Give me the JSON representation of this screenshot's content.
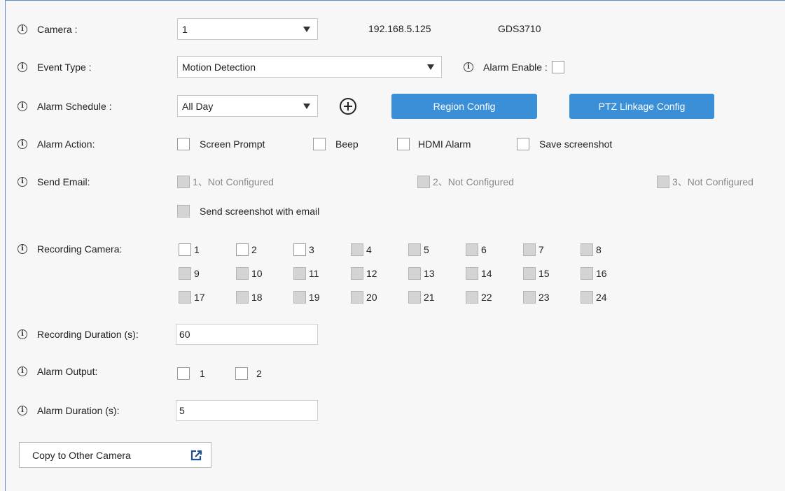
{
  "fields": {
    "camera": {
      "label": "Camera :",
      "value": "1",
      "ip": "192.168.5.125",
      "model": "GDS3710"
    },
    "event_type": {
      "label": "Event Type :",
      "value": "Motion Detection"
    },
    "alarm_enable": {
      "label": "Alarm Enable :",
      "checked": false
    },
    "alarm_schedule": {
      "label": "Alarm Schedule :",
      "value": "All Day"
    },
    "region_config": {
      "label": "Region Config"
    },
    "ptz_linkage": {
      "label": "PTZ Linkage Config"
    },
    "alarm_action": {
      "label": "Alarm Action:",
      "options": [
        "Screen Prompt",
        "Beep",
        "HDMI Alarm",
        "Save screenshot"
      ]
    },
    "send_email": {
      "label": "Send Email:",
      "options": [
        "1、Not Configured",
        "2、Not Configured",
        "3、Not Configured"
      ],
      "screenshot_label": "Send screenshot with email"
    },
    "recording_camera": {
      "label": "Recording Camera:",
      "cameras": [
        "1",
        "2",
        "3",
        "4",
        "5",
        "6",
        "7",
        "8",
        "9",
        "10",
        "11",
        "12",
        "13",
        "14",
        "15",
        "16",
        "17",
        "18",
        "19",
        "20",
        "21",
        "22",
        "23",
        "24"
      ],
      "enabled": [
        "1",
        "2",
        "3"
      ]
    },
    "recording_duration": {
      "label": "Recording Duration (s):",
      "value": "60"
    },
    "alarm_output": {
      "label": "Alarm Output:",
      "options": [
        "1",
        "2"
      ]
    },
    "alarm_duration": {
      "label": "Alarm Duration (s):",
      "value": "5"
    },
    "copy_button": {
      "label": "Copy to Other Camera"
    }
  },
  "colors": {
    "accent": "#3a8fd6",
    "frame": "#5b8fc8",
    "disabled": "#d4d4d4"
  },
  "icons": {
    "info": "info-circle-icon",
    "add": "plus-circle-icon",
    "export": "export-icon",
    "dropdown": "chevron-down-icon"
  }
}
